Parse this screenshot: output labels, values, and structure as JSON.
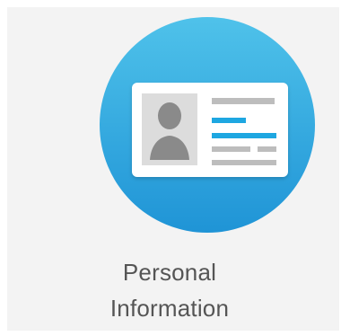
{
  "tile": {
    "title_line1": "Personal",
    "title_line2": "Information",
    "icon": "id-card-icon"
  },
  "colors": {
    "tile_background": "#f3f3f3",
    "circle_top": "#4fc2ea",
    "circle_bottom": "#1f94d6",
    "card": "#ffffff",
    "photo_background": "#dcdcdc",
    "person": "#8a8a8a",
    "accent_line": "#1ea7e1",
    "gray_line": "#bdbdbd",
    "label_text": "#555555"
  }
}
